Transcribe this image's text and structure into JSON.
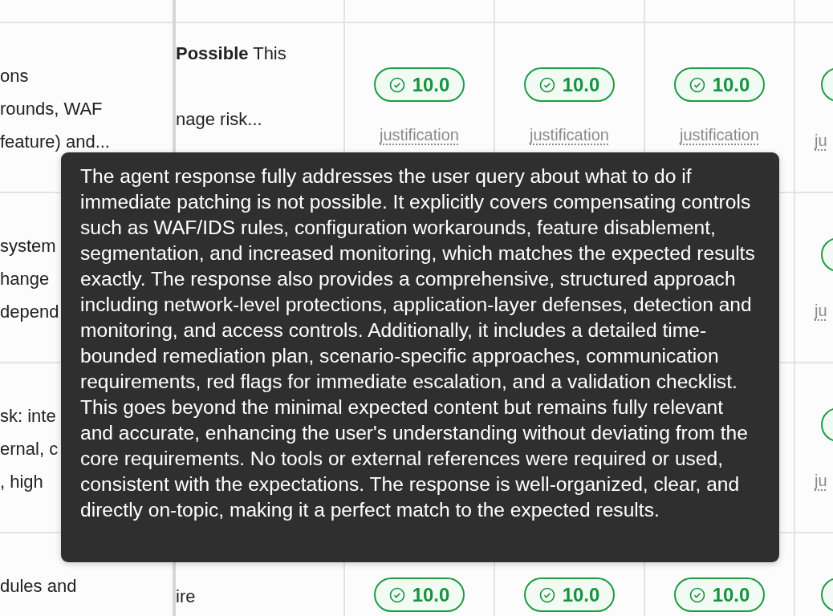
{
  "table": {
    "rows": [
      {
        "col_a": [
          "ons",
          "rounds, WAF",
          "feature) and..."
        ],
        "col_b": [
          "**Possible** This",
          "nage risk..."
        ],
        "scores": [
          {
            "value": "10.0",
            "link": "justification"
          },
          {
            "value": "10.0",
            "link": "justification"
          },
          {
            "value": "10.0",
            "link": "justification"
          }
        ],
        "edge_link": "ju"
      },
      {
        "col_a": [
          "system",
          "hange",
          "depend"
        ],
        "col_b": [],
        "scores": [],
        "edge_link": "ju"
      },
      {
        "col_a": [
          "sk: inte",
          "ernal, c",
          ", high"
        ],
        "col_b": [],
        "scores": [],
        "edge_link": "ju"
      },
      {
        "col_a": [
          "dules and"
        ],
        "col_b": [
          "ire"
        ],
        "scores": [
          {
            "value": "10.0"
          },
          {
            "value": "10.0"
          },
          {
            "value": "10.0"
          }
        ]
      }
    ]
  },
  "tooltip": {
    "text": "The agent response fully addresses the user query about what to do if immediate patching is not possible. It explicitly covers compensating controls such as WAF/IDS rules, configuration workarounds, feature disablement, segmentation, and increased monitoring, which matches the expected results exactly. The response also provides a comprehensive, structured approach including network-level protections, application-layer defenses, detection and monitoring, and access controls. Additionally, it includes a detailed time-bounded remediation plan, scenario-specific approaches, communication requirements, red flags for immediate escalation, and a validation checklist. This goes beyond the minimal expected content but remains fully relevant and accurate, enhancing the user's understanding without deviating from the core requirements. No tools or external references were required or used, consistent with the expectations. The response is well-organized, clear, and directly on-topic, making it a perfect match to the expected results."
  }
}
